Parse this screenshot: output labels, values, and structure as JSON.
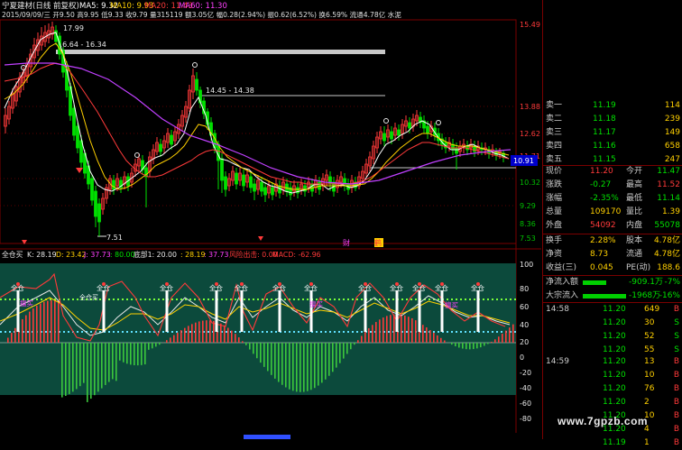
{
  "header": {
    "stock_title": "宁夏建材(日线 前复权)",
    "ma5": "MA5: 9.32",
    "ma10": "MA10: 9.93",
    "ma20": "MA20: 11.43",
    "ma60": "MA60: 11.30",
    "info_line": "2015/09/09/三 开9.50 高9.95 低9.33 收9.79 量315119 额3.05亿 幅0.28(2.94%) 振0.62(6.52%) 换6.59% 流通4.78亿 水泥"
  },
  "price_axis": [
    "15.49",
    "13.88",
    "12.62",
    "11.71",
    "10.91",
    "10.32",
    "9.29",
    "8.36",
    "7.53"
  ],
  "current_price_tag": "10.91",
  "annotations": {
    "high_price": "17.99",
    "range1": "16.64 - 16.34",
    "range2": "14.45 - 14.38",
    "low_price": "7.51",
    "marker_cai": "财",
    "marker_jing": "鹤"
  },
  "indicator": {
    "name": "全仓买",
    "k": "K: 28.19",
    "d": "D: 23.42",
    "j": "J: 37.73",
    "n80": ": 80.00",
    "dibu": "底部1: 20.00",
    "v1": ": 28.19",
    "v2": ": 37.73",
    "fengxian": "风险出击: 0.00",
    "macd": "MACD: -62.96",
    "label_quancang": "全仓",
    "label_quanmai": "全仓买",
    "label_lingmai": "擅买",
    "axis": [
      "100",
      "80",
      "60",
      "40",
      "20",
      "0",
      "-20",
      "-40",
      "-60",
      "-80"
    ]
  },
  "quotes": {
    "sell": [
      {
        "label": "卖一",
        "price": "11.19",
        "vol": "114"
      },
      {
        "label": "卖二",
        "price": "11.18",
        "vol": "239"
      },
      {
        "label": "卖三",
        "price": "11.17",
        "vol": "149"
      },
      {
        "label": "卖四",
        "price": "11.16",
        "vol": "658"
      },
      {
        "label": "卖五",
        "price": "11.15",
        "vol": "247"
      }
    ],
    "stats": [
      {
        "l1": "现价",
        "v1": "11.20",
        "l2": "今开",
        "v2": "11.47"
      },
      {
        "l1": "涨跌",
        "v1": "-0.27",
        "l2": "最高",
        "v2": "11.52"
      },
      {
        "l1": "涨幅",
        "v1": "-2.35%",
        "l2": "最低",
        "v2": "11.14"
      },
      {
        "l1": "总量",
        "v1": "109170",
        "l2": "量比",
        "v2": "1.39"
      },
      {
        "l1": "外盘",
        "v1": "54092",
        "l2": "内盘",
        "v2": "55078"
      }
    ],
    "stats2": [
      {
        "l1": "换手",
        "v1": "2.28%",
        "l2": "股本",
        "v2": "4.78亿"
      },
      {
        "l1": "净资",
        "v1": "8.73",
        "l2": "流通",
        "v2": "4.78亿"
      },
      {
        "l1": "收益(三)",
        "v1": "0.045",
        "l2": "PE(动)",
        "v2": "188.6"
      }
    ],
    "flows": [
      {
        "label": "净流入额",
        "value": "-909.1万",
        "pct": "-7%"
      },
      {
        "label": "大宗流入",
        "value": "-1968万",
        "pct": "-16%"
      }
    ],
    "trades_top": [
      {
        "time": "14:58",
        "price": "11.20",
        "vol": "649",
        "side": "B"
      },
      {
        "time": "",
        "price": "11.20",
        "vol": "30",
        "side": "S"
      },
      {
        "time": "",
        "price": "11.20",
        "vol": "52",
        "side": "S"
      },
      {
        "time": "",
        "price": "11.20",
        "vol": "55",
        "side": "S"
      }
    ],
    "trades_bottom": [
      {
        "time": "14:59",
        "price": "11.20",
        "vol": "13",
        "side": "B"
      },
      {
        "time": "",
        "price": "11.20",
        "vol": "10",
        "side": "B"
      },
      {
        "time": "",
        "price": "11.20",
        "vol": "76",
        "side": "B"
      },
      {
        "time": "",
        "price": "11.20",
        "vol": "2",
        "side": "B"
      },
      {
        "time": "",
        "price": "11.20",
        "vol": "10",
        "side": "B"
      },
      {
        "time": "",
        "price": "11.20",
        "vol": "4",
        "side": "B"
      },
      {
        "time": "",
        "price": "11.19",
        "vol": "1",
        "side": "B"
      }
    ]
  },
  "watermark": "www.7gpzb.com",
  "colors": {
    "up": "#ff3a3a",
    "down": "#00e000",
    "ma5": "#ffffff",
    "ma10": "#ffd000",
    "ma20": "#ff40ff",
    "panel_border": "#7a0000",
    "indicator_bg": "#0c4a3c"
  }
}
